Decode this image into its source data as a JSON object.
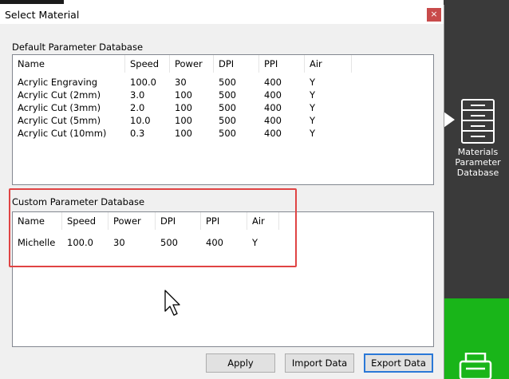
{
  "dialog": {
    "title": "Select Material",
    "close_glyph": "×"
  },
  "default_db": {
    "label": "Default Parameter Database",
    "columns": [
      "Name",
      "Speed",
      "Power",
      "DPI",
      "PPI",
      "Air"
    ],
    "rows": [
      [
        "Acrylic Engraving",
        "100.0",
        "30",
        "500",
        "400",
        "Y"
      ],
      [
        "Acrylic Cut (2mm)",
        "3.0",
        "100",
        "500",
        "400",
        "Y"
      ],
      [
        "Acrylic Cut (3mm)",
        "2.0",
        "100",
        "500",
        "400",
        "Y"
      ],
      [
        "Acrylic Cut (5mm)",
        "10.0",
        "100",
        "500",
        "400",
        "Y"
      ],
      [
        "Acrylic Cut (10mm)",
        "0.3",
        "100",
        "500",
        "400",
        "Y"
      ]
    ]
  },
  "custom_db": {
    "label": "Custom Parameter Database",
    "columns": [
      "Name",
      "Speed",
      "Power",
      "DPI",
      "PPI",
      "Air"
    ],
    "rows": [
      [
        "Michelle",
        "100.0",
        "30",
        "500",
        "400",
        "Y"
      ]
    ]
  },
  "buttons": {
    "apply": "Apply",
    "import": "Import Data",
    "export": "Export Data"
  },
  "sidebar": {
    "materials_label": "Materials Parameter Database",
    "icons": [
      "materials-database-icon",
      "printer-icon"
    ]
  },
  "colors": {
    "highlight": "#e04444",
    "sidebar_dark": "#3a3a3a",
    "sidebar_green": "#19b519",
    "focus_blue": "#2a78d7"
  }
}
